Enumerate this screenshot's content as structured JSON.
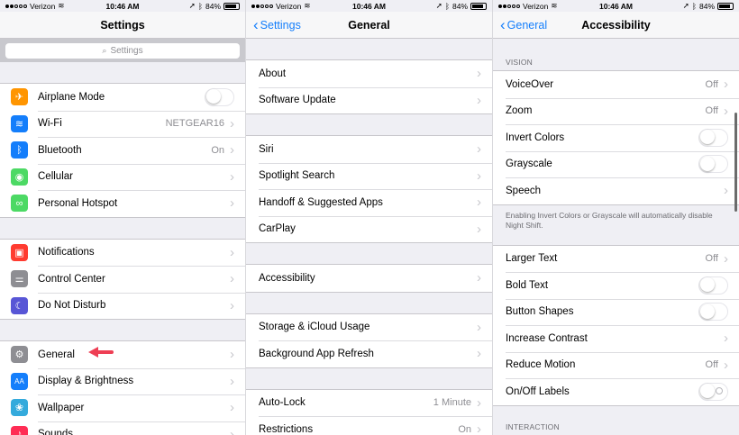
{
  "status_bar": {
    "carrier": "Verizon",
    "time": "10:46 AM",
    "battery": "84%"
  },
  "colors": {
    "accent": "#147efb",
    "annotation_arrow": "#ee3e54",
    "background": "#efeff4"
  },
  "panel_settings": {
    "title": "Settings",
    "search_placeholder": "Settings",
    "groups": [
      [
        {
          "label": "Airplane Mode",
          "icon": "airplane-icon",
          "icon_color": "#ff9500",
          "glyph": "✈",
          "control": "switch",
          "switch_on": false
        },
        {
          "label": "Wi-Fi",
          "icon": "wifi-icon",
          "icon_color": "#147efb",
          "glyph": "≋",
          "value": "NETGEAR16"
        },
        {
          "label": "Bluetooth",
          "icon": "bluetooth-icon",
          "icon_color": "#147efb",
          "glyph": "ᛒ",
          "value": "On"
        },
        {
          "label": "Cellular",
          "icon": "cellular-icon",
          "icon_color": "#4cd964",
          "glyph": "◉",
          "value": ""
        },
        {
          "label": "Personal Hotspot",
          "icon": "hotspot-icon",
          "icon_color": "#4cd964",
          "glyph": "∞",
          "value": ""
        }
      ],
      [
        {
          "label": "Notifications",
          "icon": "notifications-icon",
          "icon_color": "#ff3b30",
          "glyph": "▣",
          "value": ""
        },
        {
          "label": "Control Center",
          "icon": "control-center-icon",
          "icon_color": "#8e8e93",
          "glyph": "⚌",
          "value": ""
        },
        {
          "label": "Do Not Disturb",
          "icon": "moon-icon",
          "icon_color": "#5856d6",
          "glyph": "☾",
          "value": ""
        }
      ],
      [
        {
          "label": "General",
          "icon": "gear-icon",
          "icon_color": "#8e8e93",
          "glyph": "⚙",
          "value": ""
        },
        {
          "label": "Display & Brightness",
          "icon": "display-brightness-icon",
          "icon_color": "#147efb",
          "glyph": "AA",
          "value": ""
        },
        {
          "label": "Wallpaper",
          "icon": "wallpaper-icon",
          "icon_color": "#34aadc",
          "glyph": "❀",
          "value": ""
        },
        {
          "label": "Sounds",
          "icon": "sounds-icon",
          "icon_color": "#ff2d55",
          "glyph": "♪",
          "value": ""
        }
      ]
    ]
  },
  "panel_general": {
    "back_label": "Settings",
    "title": "General",
    "groups": [
      [
        {
          "label": "About",
          "value": ""
        },
        {
          "label": "Software Update",
          "value": ""
        }
      ],
      [
        {
          "label": "Siri",
          "value": ""
        },
        {
          "label": "Spotlight Search",
          "value": ""
        },
        {
          "label": "Handoff & Suggested Apps",
          "value": ""
        },
        {
          "label": "CarPlay",
          "value": ""
        }
      ],
      [
        {
          "label": "Accessibility",
          "value": ""
        }
      ],
      [
        {
          "label": "Storage & iCloud Usage",
          "value": ""
        },
        {
          "label": "Background App Refresh",
          "value": ""
        }
      ],
      [
        {
          "label": "Auto-Lock",
          "value": "1 Minute"
        },
        {
          "label": "Restrictions",
          "value": "On"
        }
      ]
    ]
  },
  "panel_accessibility": {
    "back_label": "General",
    "title": "Accessibility",
    "vision_header": "VISION",
    "vision_rows": [
      {
        "label": "VoiceOver",
        "value": "Off",
        "control": "chevron"
      },
      {
        "label": "Zoom",
        "value": "Off",
        "control": "chevron"
      },
      {
        "label": "Invert Colors",
        "control": "switch",
        "switch_on": false
      },
      {
        "label": "Grayscale",
        "control": "switch",
        "switch_on": false
      },
      {
        "label": "Speech",
        "value": "",
        "control": "chevron"
      }
    ],
    "vision_footer": "Enabling Invert Colors or Grayscale will automatically disable Night Shift.",
    "text_rows": [
      {
        "label": "Larger Text",
        "value": "Off",
        "control": "chevron"
      },
      {
        "label": "Bold Text",
        "control": "switch",
        "switch_on": false
      },
      {
        "label": "Button Shapes",
        "control": "switch",
        "switch_on": false
      },
      {
        "label": "Increase Contrast",
        "value": "",
        "control": "chevron"
      },
      {
        "label": "Reduce Motion",
        "value": "Off",
        "control": "chevron"
      },
      {
        "label": "On/Off Labels",
        "control": "switch",
        "switch_on": false,
        "show_label": true
      }
    ],
    "interaction_header": "INTERACTION"
  }
}
